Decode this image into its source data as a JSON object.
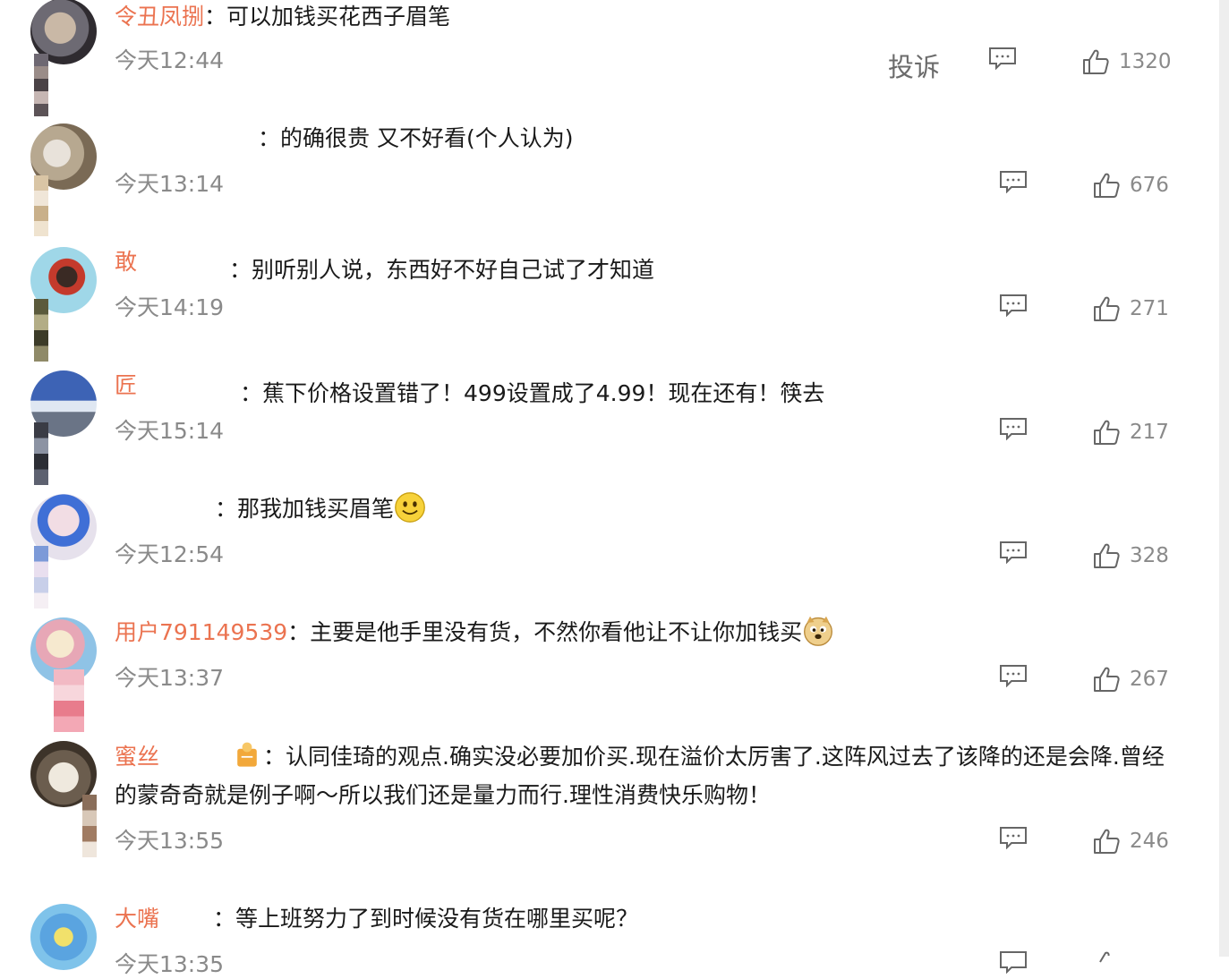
{
  "comments": [
    {
      "username": "令丑凤捌",
      "colon": "：",
      "text": "可以加钱买花西子眉笔",
      "time": "今天12:44",
      "report_label": "投诉",
      "likes": "1320"
    },
    {
      "username": "",
      "colon": "：",
      "text": "的确很贵 又不好看(个人认为)",
      "time": "今天13:14",
      "likes": "676"
    },
    {
      "username": "敢",
      "colon": "：",
      "text": "别听别人说，东西好不好自己试了才知道",
      "time": "今天14:19",
      "likes": "271"
    },
    {
      "username": "匠",
      "colon": "：",
      "text": "蕉下价格设置错了！499设置成了4.99！现在还有！筷去",
      "time": "今天15:14",
      "likes": "217"
    },
    {
      "username": "",
      "colon": "：",
      "text": "那我加钱买眉笔",
      "emoji": "smile-emoji",
      "time": "今天12:54",
      "likes": "328"
    },
    {
      "username": "用户791149539",
      "colon": "：",
      "text": "主要是他手里没有货，不然你看他让不让你加钱买",
      "emoji": "doge-emoji",
      "time": "今天13:37",
      "likes": "267"
    },
    {
      "username": "蜜丝",
      "colon": "：",
      "text": "认同佳琦的观点.确实没必要加价买.现在溢价太厉害了.这阵风过去了该降的还是会降.曾经的蒙奇奇就是例子啊～所以我们还是量力而行.理性消费快乐购物！",
      "time": "今天13:55",
      "likes": "246"
    },
    {
      "username": "大嘴",
      "colon": "：",
      "text": "等上班努力了到时候没有货在哪里买呢？",
      "time": "今天13:35",
      "likes": ""
    }
  ],
  "colors": {
    "username": "#eb7350",
    "text": "#1a1a1a",
    "meta": "#8a8a8a",
    "icon": "#666666"
  }
}
